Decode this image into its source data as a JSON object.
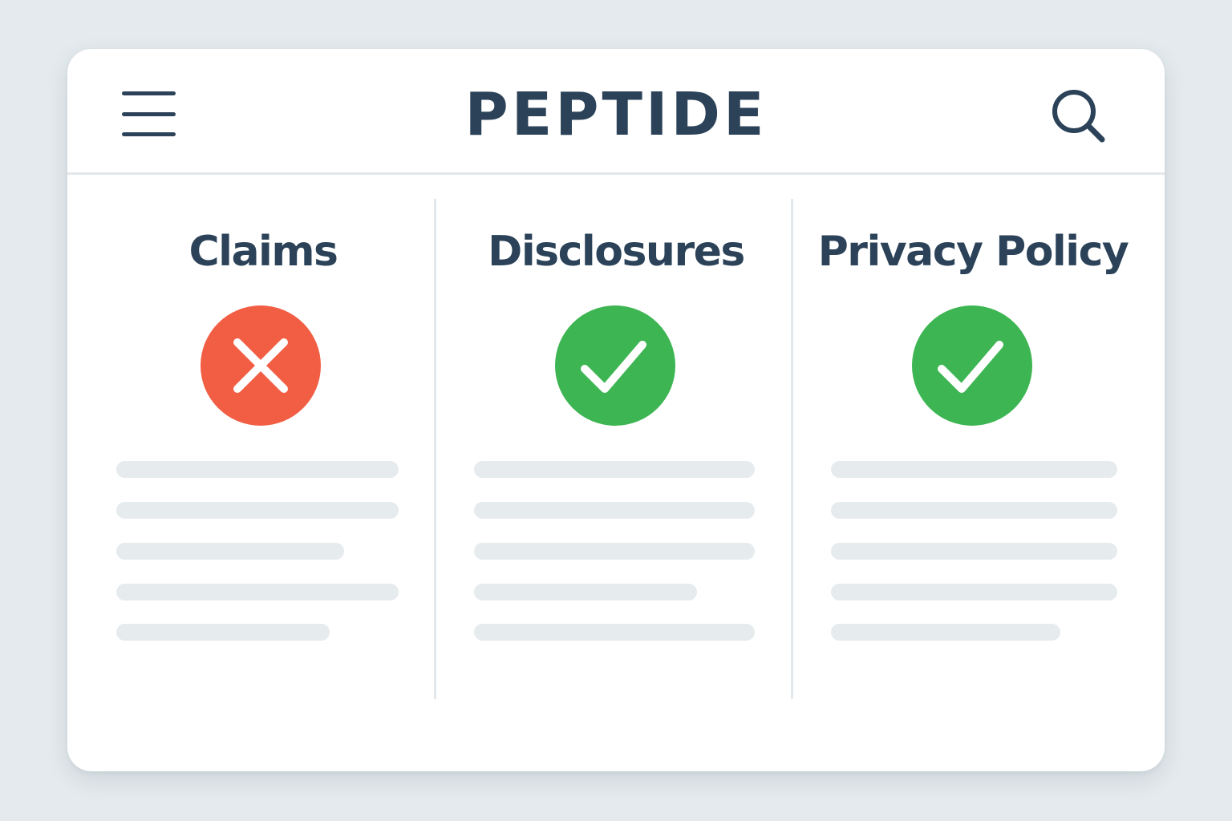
{
  "app": {
    "title": "PEPTIDE"
  },
  "header": {
    "menu_icon": "hamburger-menu-icon",
    "search_icon": "search-icon"
  },
  "columns": [
    {
      "title": "Claims",
      "status": "fail",
      "status_icon": "x-icon",
      "status_color": "#f25e44"
    },
    {
      "title": "Disclosures",
      "status": "pass",
      "status_icon": "check-icon",
      "status_color": "#3db552"
    },
    {
      "title": "Privacy Policy",
      "status": "pass",
      "status_icon": "check-icon",
      "status_color": "#3db552"
    }
  ],
  "colors": {
    "background": "#e4eaed",
    "card": "#ffffff",
    "text": "#2b4258",
    "divider": "#e2e8ec",
    "placeholder_line": "#e6ebee"
  }
}
